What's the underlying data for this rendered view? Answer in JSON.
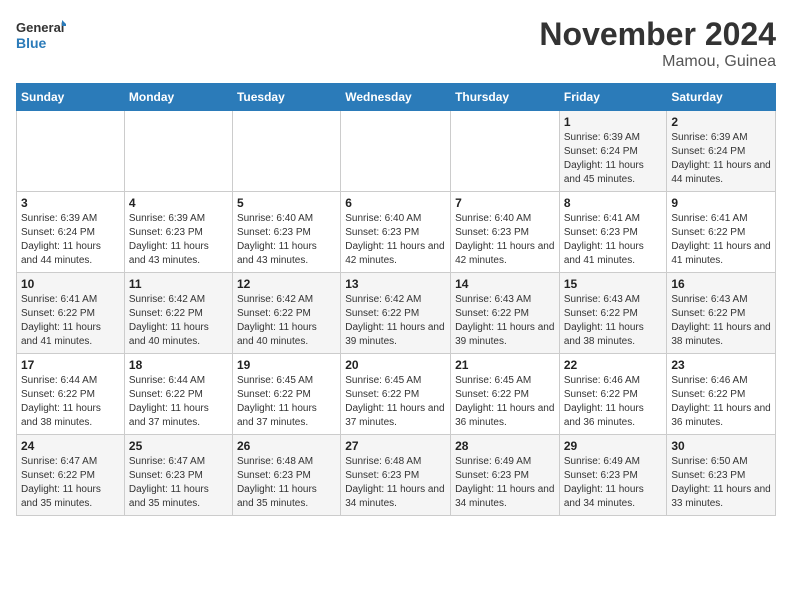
{
  "header": {
    "logo_line1": "General",
    "logo_line2": "Blue",
    "month": "November 2024",
    "location": "Mamou, Guinea"
  },
  "weekdays": [
    "Sunday",
    "Monday",
    "Tuesday",
    "Wednesday",
    "Thursday",
    "Friday",
    "Saturday"
  ],
  "weeks": [
    [
      {
        "day": "",
        "info": ""
      },
      {
        "day": "",
        "info": ""
      },
      {
        "day": "",
        "info": ""
      },
      {
        "day": "",
        "info": ""
      },
      {
        "day": "",
        "info": ""
      },
      {
        "day": "1",
        "info": "Sunrise: 6:39 AM\nSunset: 6:24 PM\nDaylight: 11 hours and 45 minutes."
      },
      {
        "day": "2",
        "info": "Sunrise: 6:39 AM\nSunset: 6:24 PM\nDaylight: 11 hours and 44 minutes."
      }
    ],
    [
      {
        "day": "3",
        "info": "Sunrise: 6:39 AM\nSunset: 6:24 PM\nDaylight: 11 hours and 44 minutes."
      },
      {
        "day": "4",
        "info": "Sunrise: 6:39 AM\nSunset: 6:23 PM\nDaylight: 11 hours and 43 minutes."
      },
      {
        "day": "5",
        "info": "Sunrise: 6:40 AM\nSunset: 6:23 PM\nDaylight: 11 hours and 43 minutes."
      },
      {
        "day": "6",
        "info": "Sunrise: 6:40 AM\nSunset: 6:23 PM\nDaylight: 11 hours and 42 minutes."
      },
      {
        "day": "7",
        "info": "Sunrise: 6:40 AM\nSunset: 6:23 PM\nDaylight: 11 hours and 42 minutes."
      },
      {
        "day": "8",
        "info": "Sunrise: 6:41 AM\nSunset: 6:23 PM\nDaylight: 11 hours and 41 minutes."
      },
      {
        "day": "9",
        "info": "Sunrise: 6:41 AM\nSunset: 6:22 PM\nDaylight: 11 hours and 41 minutes."
      }
    ],
    [
      {
        "day": "10",
        "info": "Sunrise: 6:41 AM\nSunset: 6:22 PM\nDaylight: 11 hours and 41 minutes."
      },
      {
        "day": "11",
        "info": "Sunrise: 6:42 AM\nSunset: 6:22 PM\nDaylight: 11 hours and 40 minutes."
      },
      {
        "day": "12",
        "info": "Sunrise: 6:42 AM\nSunset: 6:22 PM\nDaylight: 11 hours and 40 minutes."
      },
      {
        "day": "13",
        "info": "Sunrise: 6:42 AM\nSunset: 6:22 PM\nDaylight: 11 hours and 39 minutes."
      },
      {
        "day": "14",
        "info": "Sunrise: 6:43 AM\nSunset: 6:22 PM\nDaylight: 11 hours and 39 minutes."
      },
      {
        "day": "15",
        "info": "Sunrise: 6:43 AM\nSunset: 6:22 PM\nDaylight: 11 hours and 38 minutes."
      },
      {
        "day": "16",
        "info": "Sunrise: 6:43 AM\nSunset: 6:22 PM\nDaylight: 11 hours and 38 minutes."
      }
    ],
    [
      {
        "day": "17",
        "info": "Sunrise: 6:44 AM\nSunset: 6:22 PM\nDaylight: 11 hours and 38 minutes."
      },
      {
        "day": "18",
        "info": "Sunrise: 6:44 AM\nSunset: 6:22 PM\nDaylight: 11 hours and 37 minutes."
      },
      {
        "day": "19",
        "info": "Sunrise: 6:45 AM\nSunset: 6:22 PM\nDaylight: 11 hours and 37 minutes."
      },
      {
        "day": "20",
        "info": "Sunrise: 6:45 AM\nSunset: 6:22 PM\nDaylight: 11 hours and 37 minutes."
      },
      {
        "day": "21",
        "info": "Sunrise: 6:45 AM\nSunset: 6:22 PM\nDaylight: 11 hours and 36 minutes."
      },
      {
        "day": "22",
        "info": "Sunrise: 6:46 AM\nSunset: 6:22 PM\nDaylight: 11 hours and 36 minutes."
      },
      {
        "day": "23",
        "info": "Sunrise: 6:46 AM\nSunset: 6:22 PM\nDaylight: 11 hours and 36 minutes."
      }
    ],
    [
      {
        "day": "24",
        "info": "Sunrise: 6:47 AM\nSunset: 6:22 PM\nDaylight: 11 hours and 35 minutes."
      },
      {
        "day": "25",
        "info": "Sunrise: 6:47 AM\nSunset: 6:23 PM\nDaylight: 11 hours and 35 minutes."
      },
      {
        "day": "26",
        "info": "Sunrise: 6:48 AM\nSunset: 6:23 PM\nDaylight: 11 hours and 35 minutes."
      },
      {
        "day": "27",
        "info": "Sunrise: 6:48 AM\nSunset: 6:23 PM\nDaylight: 11 hours and 34 minutes."
      },
      {
        "day": "28",
        "info": "Sunrise: 6:49 AM\nSunset: 6:23 PM\nDaylight: 11 hours and 34 minutes."
      },
      {
        "day": "29",
        "info": "Sunrise: 6:49 AM\nSunset: 6:23 PM\nDaylight: 11 hours and 34 minutes."
      },
      {
        "day": "30",
        "info": "Sunrise: 6:50 AM\nSunset: 6:23 PM\nDaylight: 11 hours and 33 minutes."
      }
    ]
  ]
}
